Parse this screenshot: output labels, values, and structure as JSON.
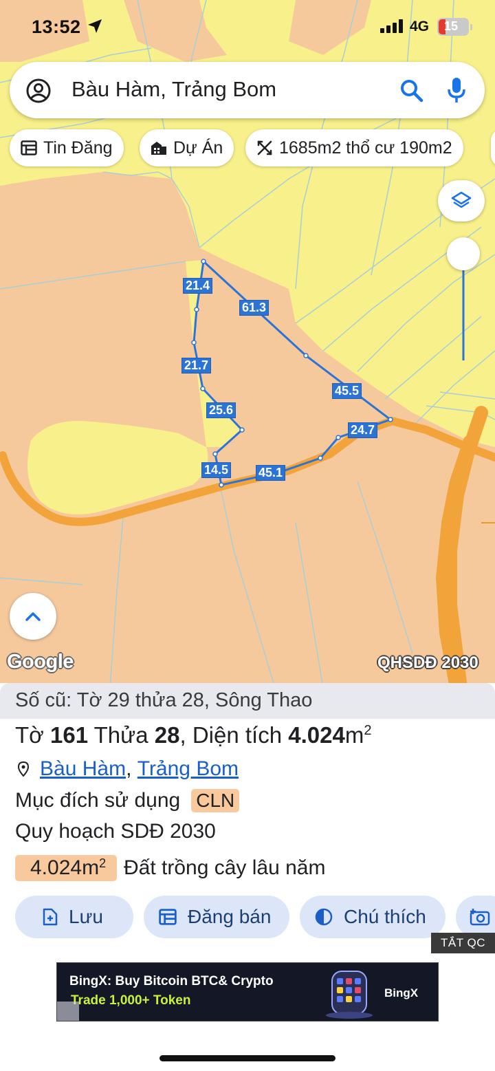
{
  "status_bar": {
    "time": "13:52",
    "network": "4G",
    "battery": "15"
  },
  "search": {
    "value": "Bàu Hàm, Trảng Bom"
  },
  "chips": [
    {
      "label": "Tin Đăng",
      "icon": "listing-icon"
    },
    {
      "label": "Dự Án",
      "icon": "buildings-icon"
    },
    {
      "label": "1685m2 thổ cư 190m2",
      "icon": "measure-icon"
    }
  ],
  "map": {
    "attribution": "Google",
    "layer_label": "QHSDĐ 2030",
    "edge_lengths": [
      "21.4",
      "61.3",
      "21.7",
      "45.5",
      "25.6",
      "24.7",
      "14.5",
      "45.1"
    ],
    "colors": {
      "perennial_land": "#f6c99d",
      "residential_land": "#f8f08a",
      "road": "#f2a33a",
      "parcel_outline": "#2b74d6"
    }
  },
  "parcel": {
    "old_reference": "Số cũ: Tờ 29 thửa 28, Sông Thao",
    "sheet_label": "Tờ",
    "sheet_no": "161",
    "plot_label": "Thửa",
    "plot_no": "28",
    "area_label": ", Diện tích",
    "area_value": "4.024",
    "area_unit": "m",
    "location_commune": "Bàu Hàm",
    "location_district": "Trảng Bom",
    "purpose_label": "Mục đích sử dụng",
    "purpose_code": "CLN",
    "plan_label": "Quy hoạch SDĐ 2030",
    "plan_area_value": "4.024m",
    "plan_area_desc": "Đất trồng cây lâu năm"
  },
  "actions": [
    {
      "label": "Lưu",
      "icon": "add-file-icon"
    },
    {
      "label": "Đăng bán",
      "icon": "listing-icon"
    },
    {
      "label": "Chú thích",
      "icon": "contrast-icon"
    }
  ],
  "ad": {
    "close_label": "TẮT QC",
    "title": "BingX: Buy Bitcoin BTC& Crypto",
    "subtitle": "Trade 1,000+ Token",
    "brand": "BingX"
  }
}
